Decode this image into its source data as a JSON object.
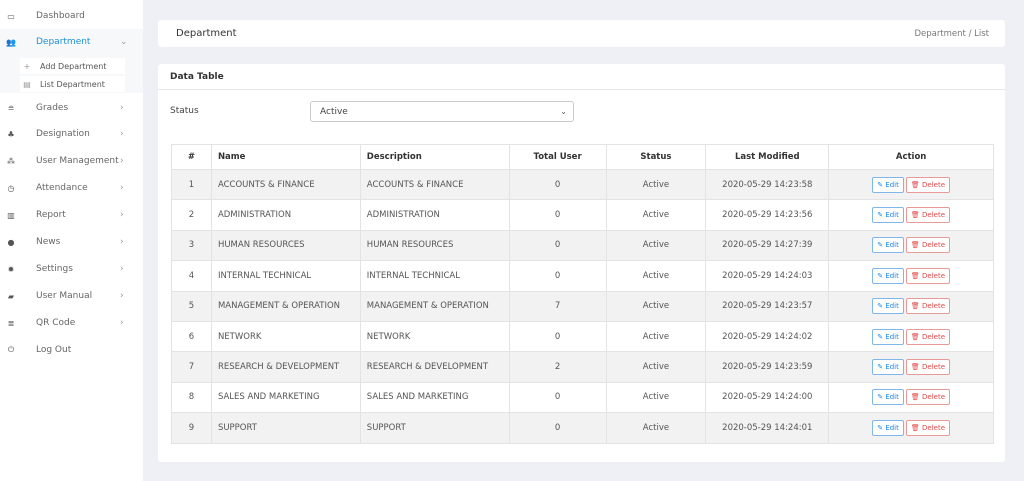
{
  "sidebar": {
    "items": [
      {
        "label": "Dashboard",
        "icon": "laptop-icon",
        "chevron": ""
      },
      {
        "label": "Department",
        "icon": "users-icon",
        "chevron": "⌄",
        "active": true
      },
      {
        "label": "Grades",
        "icon": "graduation-cap-icon",
        "chevron": "›"
      },
      {
        "label": "Designation",
        "icon": "sitemap-user-icon",
        "chevron": "›"
      },
      {
        "label": "User Management",
        "icon": "sitemap-icon",
        "chevron": "›"
      },
      {
        "label": "Attendance",
        "icon": "clock-icon",
        "chevron": "›"
      },
      {
        "label": "Report",
        "icon": "bar-chart-icon",
        "chevron": "›"
      },
      {
        "label": "News",
        "icon": "info-icon",
        "chevron": "›"
      },
      {
        "label": "Settings",
        "icon": "gear-icon",
        "chevron": "›"
      },
      {
        "label": "User Manual",
        "icon": "book-icon",
        "chevron": "›"
      },
      {
        "label": "QR Code",
        "icon": "qrcode-icon",
        "chevron": "›"
      },
      {
        "label": "Log Out",
        "icon": "power-icon",
        "chevron": ""
      }
    ],
    "submenu": [
      {
        "label": "Add Department",
        "icon": "plus-icon"
      },
      {
        "label": "List Department",
        "icon": "list-icon"
      }
    ]
  },
  "header": {
    "title": "Department",
    "breadcrumb": "Department /  List"
  },
  "card": {
    "title": "Data Table",
    "status_label": "Status",
    "status_value": "Active"
  },
  "table": {
    "columns": [
      "#",
      "Name",
      "Description",
      "Total User",
      "Status",
      "Last Modified",
      "Action"
    ],
    "edit_label": "Edit",
    "delete_label": "Delete",
    "rows": [
      [
        "1",
        "ACCOUNTS & FINANCE",
        "ACCOUNTS & FINANCE",
        "0",
        "Active",
        "2020-05-29 14:23:58"
      ],
      [
        "2",
        "ADMINISTRATION",
        "ADMINISTRATION",
        "0",
        "Active",
        "2020-05-29 14:23:56"
      ],
      [
        "3",
        "HUMAN RESOURCES",
        "HUMAN RESOURCES",
        "0",
        "Active",
        "2020-05-29 14:27:39"
      ],
      [
        "4",
        "INTERNAL TECHNICAL",
        "INTERNAL TECHNICAL",
        "0",
        "Active",
        "2020-05-29 14:24:03"
      ],
      [
        "5",
        "MANAGEMENT & OPERATION",
        "MANAGEMENT & OPERATION",
        "7",
        "Active",
        "2020-05-29 14:23:57"
      ],
      [
        "6",
        "NETWORK",
        "NETWORK",
        "0",
        "Active",
        "2020-05-29 14:24:02"
      ],
      [
        "7",
        "RESEARCH & DEVELOPMENT",
        "RESEARCH & DEVELOPMENT",
        "2",
        "Active",
        "2020-05-29 14:23:59"
      ],
      [
        "8",
        "SALES AND MARKETING",
        "SALES AND MARKETING",
        "0",
        "Active",
        "2020-05-29 14:24:00"
      ],
      [
        "9",
        "SUPPORT",
        "SUPPORT",
        "0",
        "Active",
        "2020-05-29 14:24:01"
      ]
    ]
  },
  "colors": {
    "accent": "#1e90d6",
    "edit": "#1e88e5",
    "delete": "#e04848",
    "background": "#eef0f6"
  }
}
